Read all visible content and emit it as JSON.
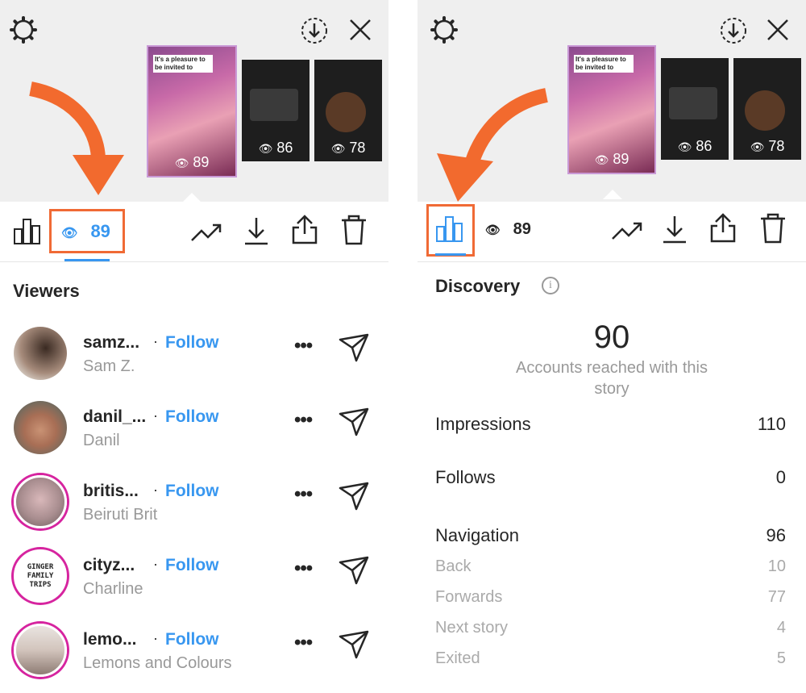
{
  "left": {
    "story_views": [
      "89",
      "86",
      "78"
    ],
    "active_count": "89",
    "viewers_title": "Viewers",
    "viewers": [
      {
        "username": "samz...",
        "fullname": "Sam Z.",
        "follow": "Follow"
      },
      {
        "username": "danil_...",
        "fullname": "Danil",
        "follow": "Follow"
      },
      {
        "username": "britis...",
        "fullname": "Beiruti Brit",
        "follow": "Follow"
      },
      {
        "username": "cityz...",
        "fullname": "Charline",
        "follow": "Follow"
      },
      {
        "username": "lemo...",
        "fullname": "Lemons and Colours",
        "follow": "Follow"
      }
    ],
    "avatar_text_ginger": "GINGER FAMILY TRIPS",
    "separator": "·",
    "more_glyph": "•••"
  },
  "right": {
    "story_views": [
      "89",
      "86",
      "78"
    ],
    "view_count": "89",
    "discovery_title": "Discovery",
    "reach_value": "90",
    "reach_label": "Accounts reached with this story",
    "impressions_label": "Impressions",
    "impressions_value": "110",
    "follows_label": "Follows",
    "follows_value": "0",
    "navigation_label": "Navigation",
    "navigation_value": "96",
    "nav": [
      {
        "label": "Back",
        "value": "10"
      },
      {
        "label": "Forwards",
        "value": "77"
      },
      {
        "label": "Next story",
        "value": "4"
      },
      {
        "label": "Exited",
        "value": "5"
      }
    ]
  },
  "story_caption": "It's a pleasure to be invited to",
  "colors": {
    "accent": "#3897f0",
    "highlight": "#f06a35",
    "arrow": "#f26a2e",
    "ring": "#d6249f"
  },
  "icons": [
    "settings-icon",
    "download-circle-icon",
    "close-icon",
    "insights-icon",
    "eye-icon",
    "trend-icon",
    "download-icon",
    "share-icon",
    "trash-icon",
    "send-icon",
    "info-icon"
  ]
}
